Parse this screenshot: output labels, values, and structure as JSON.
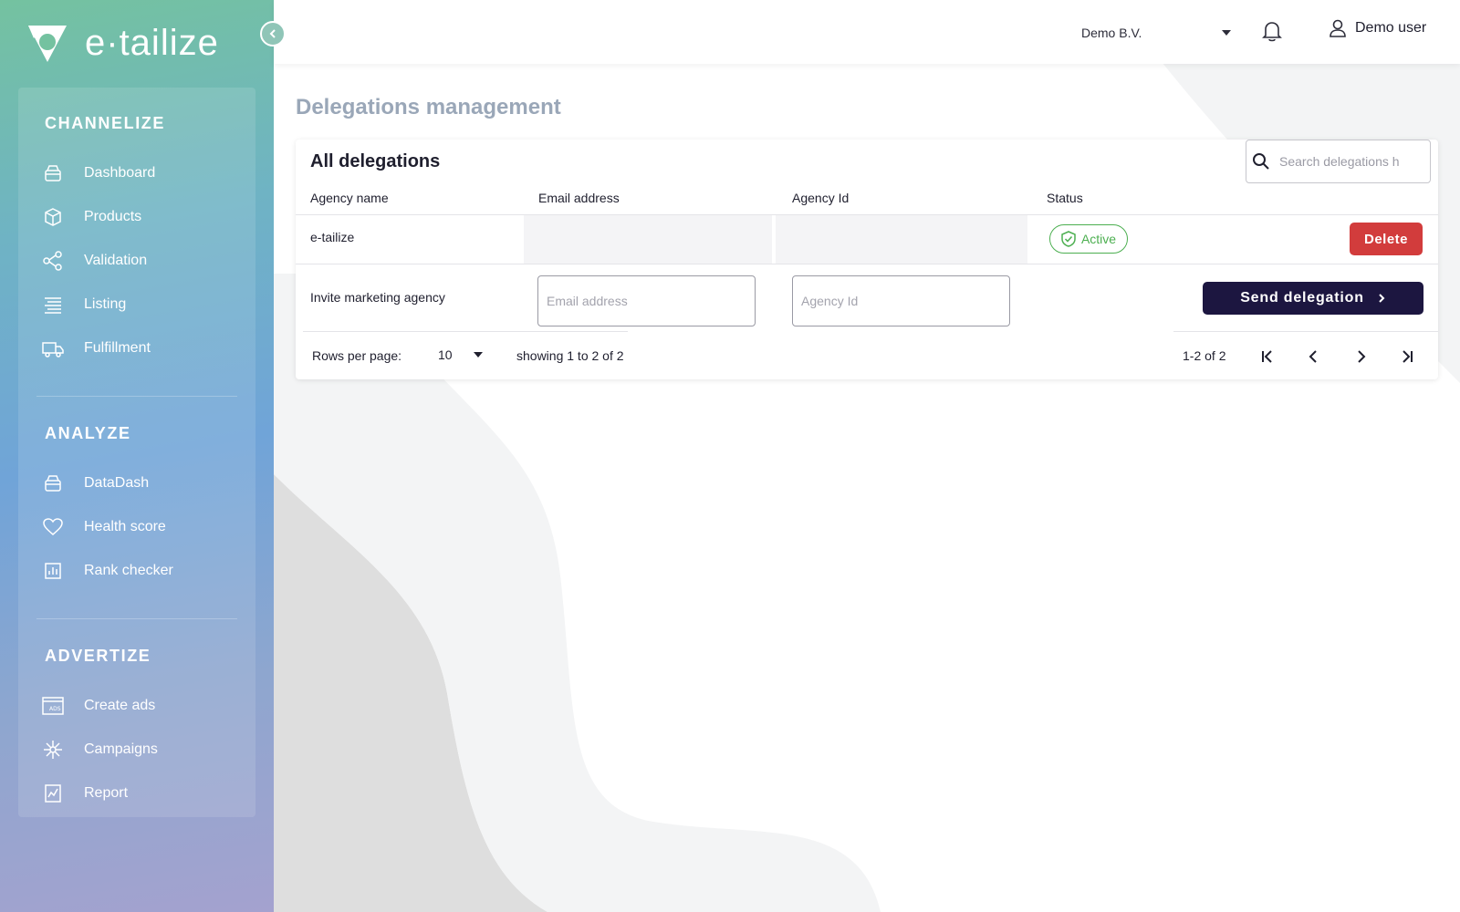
{
  "brand": {
    "name": "e·tailize"
  },
  "sidebar": {
    "sections": [
      {
        "title": "CHANNELIZE",
        "items": [
          {
            "label": "Dashboard",
            "icon": "dashboard-icon"
          },
          {
            "label": "Products",
            "icon": "box-icon"
          },
          {
            "label": "Validation",
            "icon": "share-icon"
          },
          {
            "label": "Listing",
            "icon": "list-icon"
          },
          {
            "label": "Fulfillment",
            "icon": "truck-icon"
          }
        ]
      },
      {
        "title": "ANALYZE",
        "items": [
          {
            "label": "DataDash",
            "icon": "dashboard-icon"
          },
          {
            "label": "Health score",
            "icon": "heart-icon"
          },
          {
            "label": "Rank checker",
            "icon": "bar-chart-icon"
          }
        ]
      },
      {
        "title": "ADVERTIZE",
        "items": [
          {
            "label": "Create ads",
            "icon": "ads-icon"
          },
          {
            "label": "Campaigns",
            "icon": "network-icon"
          },
          {
            "label": "Report",
            "icon": "report-icon"
          }
        ]
      }
    ]
  },
  "header": {
    "company": "Demo B.V.",
    "user": "Demo user"
  },
  "page": {
    "title": "Delegations management",
    "card_title": "All delegations",
    "search_placeholder": "Search delegations h",
    "columns": [
      "Agency name",
      "Email address",
      "Agency Id",
      "Status"
    ],
    "rows": [
      {
        "agency_name": "e-tailize",
        "email": "",
        "agency_id": "",
        "status": "Active",
        "action": "Delete"
      }
    ],
    "invite": {
      "label": "Invite marketing agency",
      "email_placeholder": "Email address",
      "agency_id_placeholder": "Agency Id",
      "send_label": "Send delegation"
    },
    "footer": {
      "rows_per_page_label": "Rows per page:",
      "rows_per_page_value": "10",
      "showing": "showing 1 to 2 of 2",
      "range": "1-2 of 2"
    }
  },
  "colors": {
    "delete": "#d23c3c",
    "send": "#1c1640",
    "active": "#4caf50",
    "title": "#9aa7b8"
  }
}
